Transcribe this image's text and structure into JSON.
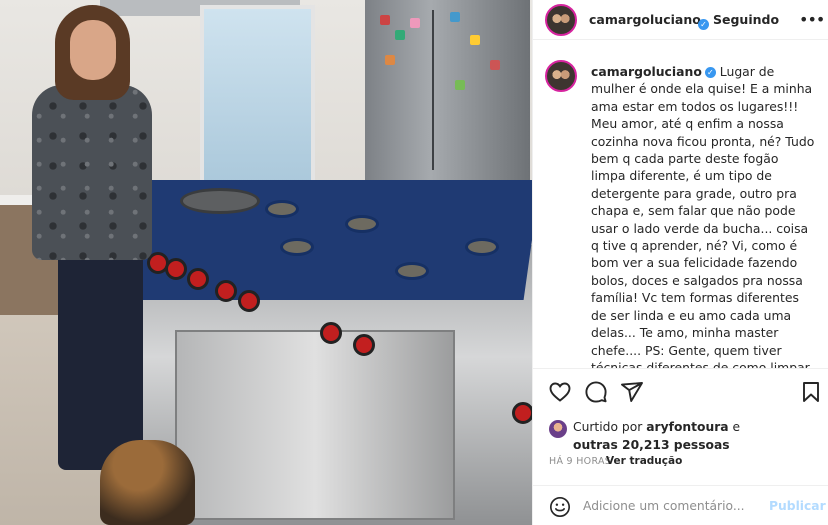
{
  "post": {
    "username": "camargoluciano",
    "follow_status": "Seguindo",
    "caption": "Lugar de mulher é onde ela quise! E a minha ama estar em todos os lugares!!! Meu amor, até q enfim a nossa cozinha nova ficou pronta, né? Tudo bem q cada parte deste fogão limpa diferente, é um tipo de detergente para grade, outro pra chapa e, sem falar que não pode usar o lado verde da bucha... coisa q tive q aprender, né? Vi, como é bom ver a sua felicidade fazendo bolos, doces e salgados pra nossa família! Vc tem formas diferentes de ser linda e eu amo cada uma delas... Te amo, minha master chefe.... PS: Gente, quem tiver técnicas diferentes de como limpar um fogão, pode mandar aqui... kkkkkk há... O",
    "likes_prefix": "Curtido por",
    "liked_by": "aryfontoura",
    "likes_and": "e",
    "others": "outras 20,213 pessoas",
    "time_ago": "HÁ 9 HORAS",
    "translate_label": "Ver tradução",
    "comment_placeholder": "Adicione um comentário...",
    "publish_label": "Publicar"
  },
  "icons": {
    "verified": "verified-badge-icon",
    "more": "more-options-icon",
    "like": "heart-icon",
    "comment": "comment-icon",
    "share": "share-icon",
    "save": "bookmark-icon",
    "emoji": "emoji-icon"
  },
  "colors": {
    "verified": "#3897f0",
    "publish_disabled": "#b3dbff",
    "meta_gray": "#8e8e8e"
  }
}
